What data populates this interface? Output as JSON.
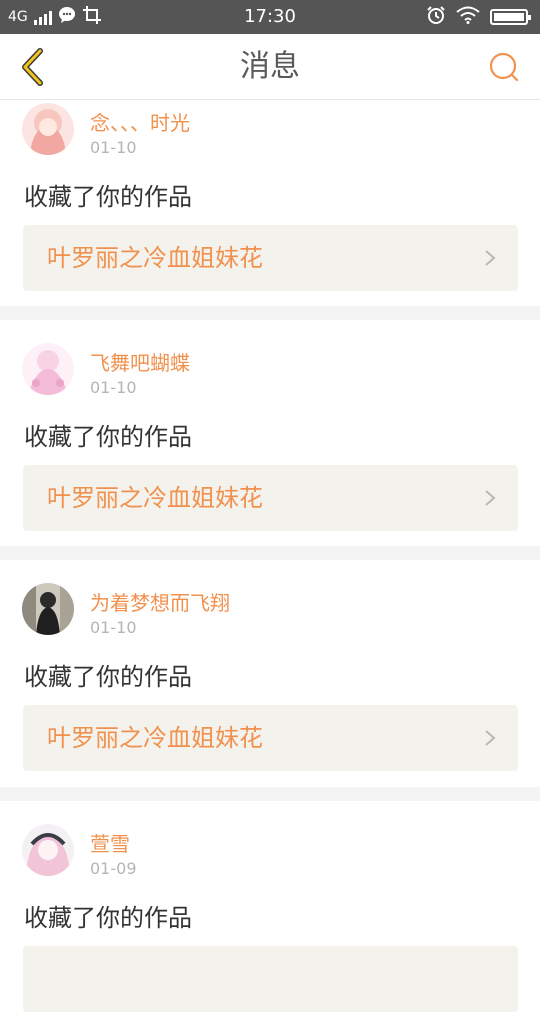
{
  "status_bar": {
    "network": "4G",
    "time": "17:30"
  },
  "header": {
    "title": "消息"
  },
  "messages": [
    {
      "user": "念、、、时光",
      "date": "01-10",
      "action": "收藏了你的作品",
      "work": "叶罗丽之冷血姐妹花"
    },
    {
      "user": "飞舞吧蝴蝶",
      "date": "01-10",
      "action": "收藏了你的作品",
      "work": "叶罗丽之冷血姐妹花"
    },
    {
      "user": "为着梦想而飞翔",
      "date": "01-10",
      "action": "收藏了你的作品",
      "work": "叶罗丽之冷血姐妹花"
    },
    {
      "user": "萱雪",
      "date": "01-09",
      "action": "收藏了你的作品",
      "work": ""
    }
  ],
  "colors": {
    "accent": "#f2914d",
    "status_bar_bg": "#555555",
    "card_bg": "#f3f2ec",
    "separator": "#f4f4f4"
  },
  "icons": {
    "back": "chevron-left-icon",
    "search": "search-icon",
    "arrow": "chevron-right-icon"
  }
}
